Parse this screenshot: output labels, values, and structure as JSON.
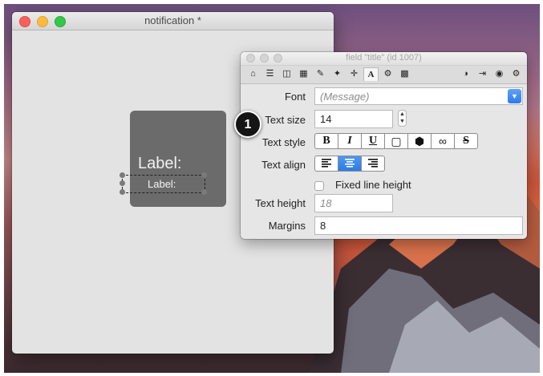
{
  "notification_window": {
    "title": "notification *",
    "card_label": "Label:",
    "selected_label": "Label:"
  },
  "inspector": {
    "title": "field \"title\" (id 1007)",
    "toolbar_icons": [
      "home-icon",
      "list-icon",
      "database-icon",
      "table-icon",
      "pencil-icon",
      "magic-wand-icon",
      "move-icon",
      "text-icon",
      "gears-icon",
      "grid-icon",
      "lock-icon",
      "exit-icon",
      "target-icon",
      "gear-icon"
    ],
    "font_label": "Font",
    "font_value": "(Message)",
    "text_size_label": "Text size",
    "text_size_value": "14",
    "text_style_label": "Text style",
    "style_buttons": [
      "B",
      "I",
      "U",
      "▢",
      "⬢",
      "∞",
      "S"
    ],
    "text_align_label": "Text align",
    "fixed_line_height_label": "Fixed line height",
    "fixed_line_height_checked": false,
    "text_height_label": "Text height",
    "text_height_placeholder": "18",
    "margins_label": "Margins",
    "margins_value": "8"
  },
  "callout": {
    "number": "1"
  },
  "colors": {
    "accent": "#2f7ae8",
    "close": "#fc605c",
    "minimize": "#fdbc40",
    "zoom": "#34c84a"
  }
}
